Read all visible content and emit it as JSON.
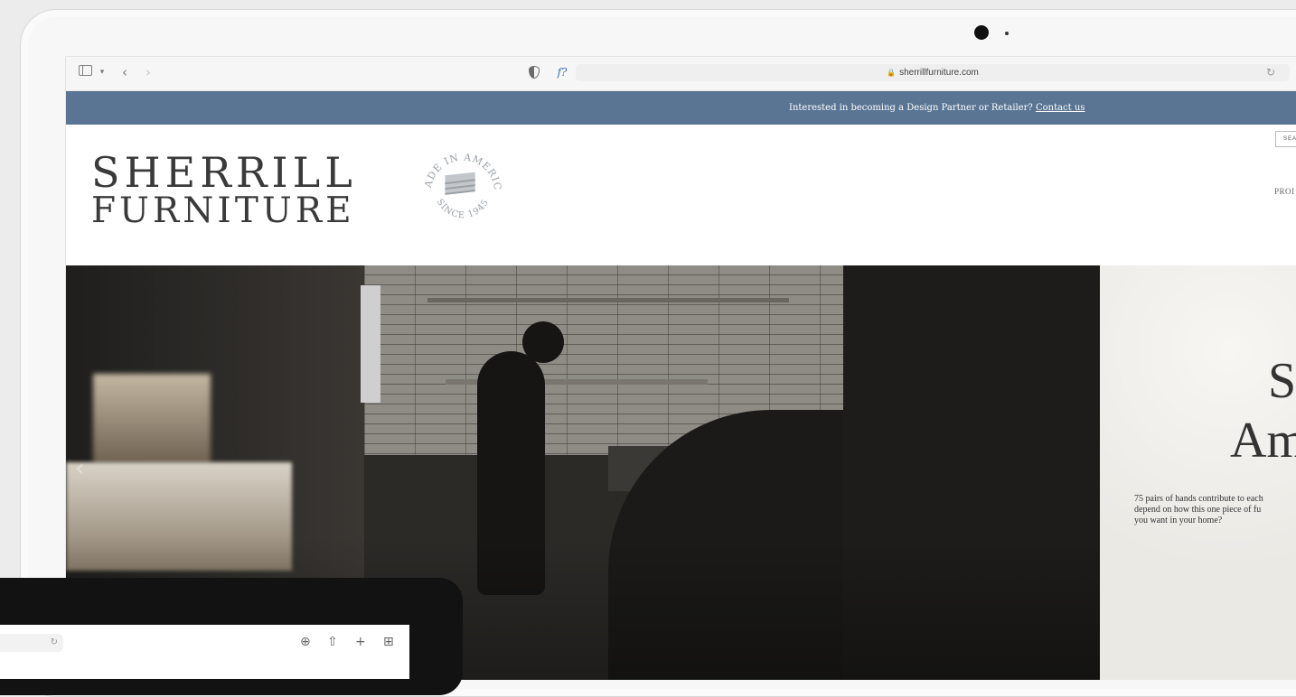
{
  "browser": {
    "url": "sherrillfurniture.com",
    "format_label": "f?",
    "icons": [
      "sidebar-icon",
      "chevron-down-icon",
      "back-icon",
      "forward-icon",
      "shield-icon",
      "reload-icon"
    ]
  },
  "banner": {
    "message": "Interested in becoming a Design Partner or Retailer?",
    "link": "Contact us",
    "color": "#5a7594"
  },
  "header": {
    "logo_line1": "SHERRILL",
    "logo_line2": "FURNITURE",
    "seal_top": "MADE IN AMERICA",
    "seal_bottom": "SINCE 1945",
    "search_label": "SEA",
    "nav_item": "PROI"
  },
  "hero": {
    "panel_title_line1": "S",
    "panel_title_line2": "Am",
    "panel_text": "75 pairs of hands contribute to each\ndepend on how this one piece of fu\nyou want in your home?"
  },
  "ipad": {
    "url_reload": "↻",
    "icons": [
      "download-icon",
      "share-icon",
      "new-tab-icon",
      "tabs-grid-icon"
    ],
    "glyphs": [
      "⊕",
      "⇧",
      "+",
      "⊞"
    ]
  }
}
